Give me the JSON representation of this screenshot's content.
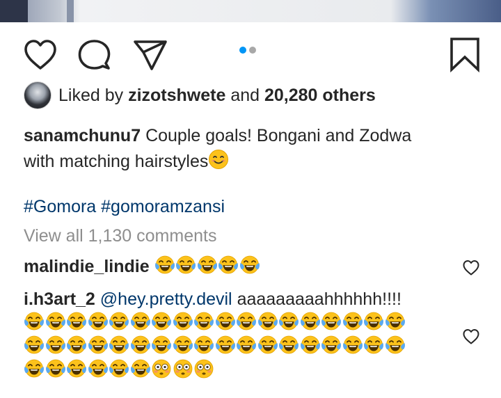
{
  "post": {
    "likes": {
      "prefix": "Liked by",
      "user": "zizotshwete",
      "connector": "and",
      "count": "20,280 others"
    },
    "caption": {
      "username": "sanamchunu7",
      "text_line1": "Couple goals! Bongani and Zodwa",
      "text_line2": "with matching hairstyles"
    },
    "hashtags": "#Gomora #gomoramzansi",
    "view_all_comments": "View all 1,130 comments",
    "carousel": {
      "active_index": 0,
      "total": 2
    }
  },
  "comments": [
    {
      "username": "malindie_lindie",
      "emojis": [
        "tears-of-joy",
        "tears-of-joy",
        "tears-of-joy",
        "tears-of-joy",
        "tears-of-joy"
      ]
    },
    {
      "username": "i.h3art_2",
      "mention": "@hey.pretty.devil",
      "text": "aaaaaaaaahhhhhh!!!!",
      "emoji_lines": [
        [
          "tears-of-joy",
          "tears-of-joy",
          "tears-of-joy",
          "tears-of-joy",
          "tears-of-joy",
          "tears-of-joy",
          "tears-of-joy",
          "tears-of-joy",
          "tears-of-joy",
          "tears-of-joy",
          "tears-of-joy",
          "tears-of-joy",
          "tears-of-joy",
          "tears-of-joy",
          "tears-of-joy",
          "tears-of-joy",
          "tears-of-joy",
          "tears-of-joy"
        ],
        [
          "tears-of-joy",
          "tears-of-joy",
          "tears-of-joy",
          "tears-of-joy",
          "tears-of-joy",
          "tears-of-joy",
          "tears-of-joy",
          "tears-of-joy",
          "tears-of-joy",
          "tears-of-joy",
          "tears-of-joy",
          "tears-of-joy",
          "tears-of-joy",
          "tears-of-joy",
          "tears-of-joy",
          "tears-of-joy",
          "tears-of-joy",
          "tears-of-joy"
        ],
        [
          "tears-of-joy",
          "tears-of-joy",
          "tears-of-joy",
          "tears-of-joy",
          "tears-of-joy",
          "tears-of-joy",
          "flushed",
          "flushed",
          "flushed"
        ]
      ]
    }
  ],
  "colors": {
    "text": "#262626",
    "link": "#00376b",
    "muted": "#8e8e8e",
    "dot_active": "#0095f6",
    "dot_inactive": "#a8a8a8"
  }
}
